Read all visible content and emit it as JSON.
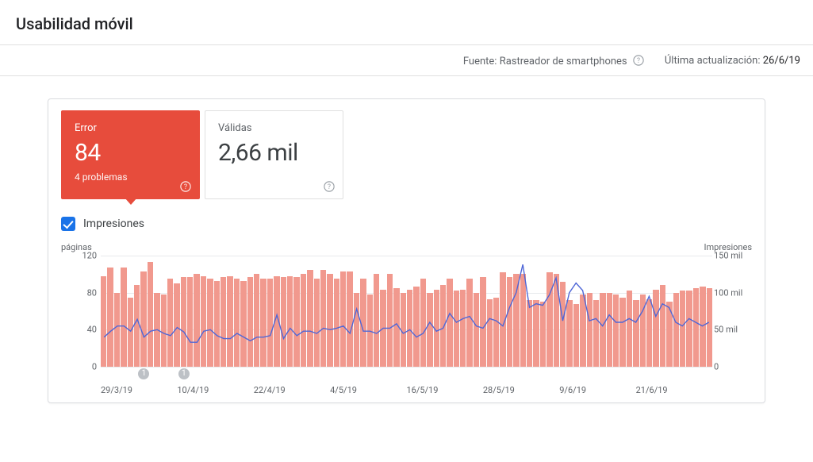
{
  "header": {
    "title": "Usabilidad móvil"
  },
  "subbar": {
    "source_label": "Fuente:",
    "source_value": "Rastreador de smartphones",
    "updated_label": "Última actualización:",
    "updated_value": "26/6/19"
  },
  "cards": {
    "error": {
      "title": "Error",
      "value": "84",
      "problems": "4 problemas"
    },
    "valid": {
      "title": "Válidas",
      "value": "2,66 mil"
    }
  },
  "impressions": {
    "label": "Impresiones",
    "checked": true
  },
  "chart_data": {
    "type": "bar+line",
    "left_axis_title": "páginas",
    "right_axis_title": "Impresiones",
    "left": {
      "ticks": [
        "0",
        "40",
        "80",
        "120"
      ],
      "min": 0,
      "max": 120
    },
    "right": {
      "ticks": [
        "0",
        "50 mil",
        "100 mil",
        "150 mil"
      ],
      "min": 0,
      "max": 150
    },
    "x_labels": [
      "29/3/19",
      "10/4/19",
      "22/4/19",
      "4/5/19",
      "16/5/19",
      "28/5/19",
      "9/6/19",
      "21/6/19"
    ],
    "markers": [
      {
        "label": "1",
        "x_index": 6
      },
      {
        "label": "1",
        "x_index": 12
      }
    ],
    "series": [
      {
        "name": "Errores (páginas)",
        "render": "bar",
        "axis": "left",
        "color": "#f1998e",
        "values": [
          98,
          107,
          80,
          107,
          75,
          88,
          103,
          113,
          80,
          78,
          95,
          90,
          97,
          97,
          100,
          98,
          95,
          93,
          97,
          98,
          95,
          93,
          97,
          100,
          95,
          95,
          98,
          97,
          98,
          97,
          100,
          105,
          95,
          105,
          100,
          95,
          103,
          103,
          80,
          95,
          78,
          100,
          83,
          100,
          85,
          80,
          83,
          87,
          95,
          80,
          83,
          88,
          95,
          82,
          83,
          95,
          80,
          97,
          73,
          75,
          102,
          97,
          100,
          100,
          72,
          72,
          70,
          102,
          100,
          92,
          72,
          68,
          78,
          80,
          72,
          80,
          80,
          78,
          75,
          82,
          72,
          78,
          73,
          83,
          88,
          70,
          80,
          82,
          82,
          85,
          87,
          85
        ]
      },
      {
        "name": "Impresiones",
        "render": "line",
        "axis": "right",
        "color": "#4f67d7",
        "values": [
          40,
          48,
          55,
          55,
          48,
          64,
          40,
          48,
          50,
          45,
          42,
          53,
          47,
          33,
          33,
          48,
          50,
          42,
          38,
          38,
          45,
          40,
          35,
          40,
          40,
          42,
          70,
          38,
          52,
          42,
          48,
          48,
          45,
          52,
          50,
          52,
          55,
          45,
          78,
          48,
          48,
          45,
          52,
          52,
          58,
          45,
          50,
          40,
          45,
          60,
          48,
          52,
          72,
          60,
          65,
          68,
          55,
          52,
          65,
          62,
          55,
          80,
          100,
          138,
          80,
          85,
          83,
          97,
          120,
          62,
          100,
          113,
          103,
          62,
          65,
          55,
          70,
          60,
          60,
          65,
          60,
          75,
          95,
          68,
          85,
          80,
          60,
          55,
          65,
          60,
          55,
          60
        ]
      }
    ]
  }
}
